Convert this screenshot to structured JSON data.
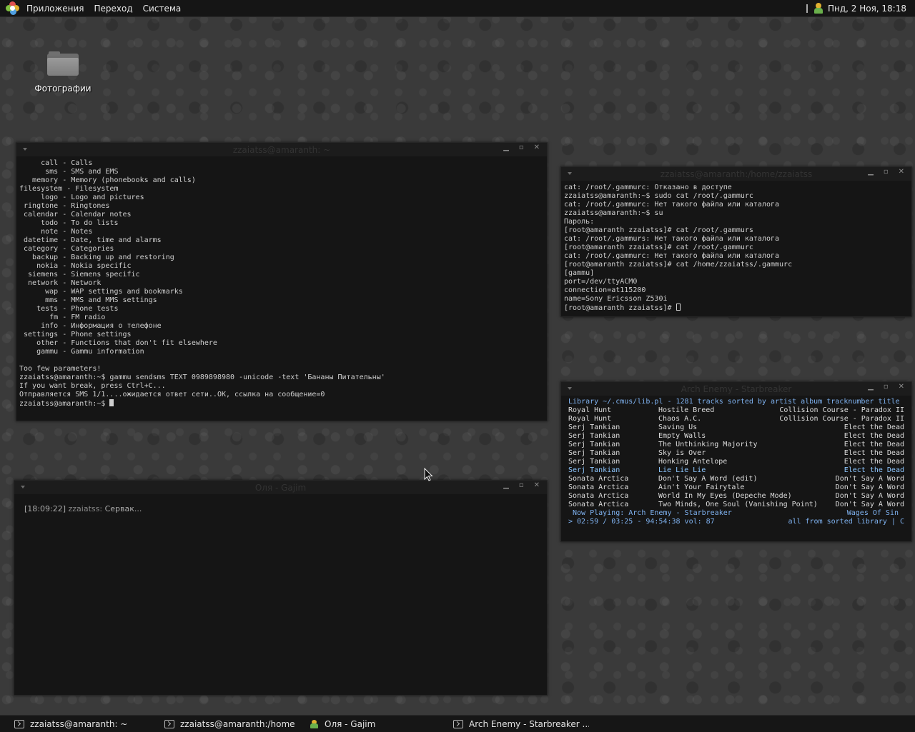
{
  "top_panel": {
    "menus": [
      "Приложения",
      "Переход",
      "Система"
    ],
    "clock": "Пнд,  2 Ноя, 18:18"
  },
  "desktop": {
    "icons": [
      {
        "label": "Фотографии",
        "icon": "folder-icon"
      }
    ]
  },
  "windows": {
    "terminal_main": {
      "title": "zzaiatss@amaranth: ~",
      "lines": [
        "     call - Calls",
        "      sms - SMS and EMS",
        "   memory - Memory (phonebooks and calls)",
        "filesystem - Filesystem",
        "     logo - Logo and pictures",
        " ringtone - Ringtones",
        " calendar - Calendar notes",
        "     todo - To do lists",
        "     note - Notes",
        " datetime - Date, time and alarms",
        " category - Categories",
        "   backup - Backing up and restoring",
        "    nokia - Nokia specific",
        "  siemens - Siemens specific",
        "  network - Network",
        "      wap - WAP settings and bookmarks",
        "      mms - MMS and MMS settings",
        "    tests - Phone tests",
        "       fm - FM radio",
        "     info - Информация о телефоне",
        " settings - Phone settings",
        "    other - Functions that don't fit elsewhere",
        "    gammu - Gammu information",
        "",
        "Too few parameters!",
        "zzaiatss@amaranth:~$ gammu sendsms TEXT 0989898980 -unicode -text 'Бананы Питательны'",
        "If you want break, press Ctrl+C...",
        "Отправляется SMS 1/1....ожидается ответ сети..OK, ссылка на сообщение=0"
      ],
      "prompt": "zzaiatss@amaranth:~$ "
    },
    "terminal_root": {
      "title": "zzaiatss@amaranth:/home/zzaiatss",
      "lines": [
        "cat: /root/.gammurc: Отказано в доступе",
        "zzaiatss@amaranth:~$ sudo cat /root/.gammurc",
        "cat: /root/.gammurc: Нет такого файла или каталога",
        "zzaiatss@amaranth:~$ su",
        "Пароль:",
        "[root@amaranth zzaiatss]# cat /root/.gammurs",
        "cat: /root/.gammurs: Нет такого файла или каталога",
        "[root@amaranth zzaiatss]# cat /root/.gammurc",
        "cat: /root/.gammurc: Нет такого файла или каталога",
        "[root@amaranth zzaiatss]# cat /home/zzaiatss/.gammurc",
        "[gammu]",
        "port=/dev/ttyACM0",
        "connection=at115200",
        "name=Sony Ericsson Z530i"
      ],
      "prompt": "[root@amaranth zzaiatss]# "
    },
    "cmus": {
      "title": "Arch Enemy - Starbreaker",
      "header": "Library ~/.cmus/lib.pl - 1281 tracks sorted by artist album tracknumber title",
      "tracks": [
        {
          "artist": "Royal Hunt",
          "title": "Hostile Breed",
          "album": "Collision Course - Paradox II"
        },
        {
          "artist": "Royal Hunt",
          "title": "Chaos A.C.",
          "album": "Collision Course - Paradox II"
        },
        {
          "artist": "Serj Tankian",
          "title": "Saving Us",
          "album": "Elect the Dead"
        },
        {
          "artist": "Serj Tankian",
          "title": "Empty Walls",
          "album": "Elect the Dead"
        },
        {
          "artist": "Serj Tankian",
          "title": "The Unthinking Majority",
          "album": "Elect the Dead"
        },
        {
          "artist": "Serj Tankian",
          "title": "Sky is Over",
          "album": "Elect the Dead"
        },
        {
          "artist": "Serj Tankian",
          "title": "Honking Antelope",
          "album": "Elect the Dead"
        },
        {
          "artist": "Serj Tankian",
          "title": "Lie Lie Lie",
          "album": "Elect the Dead",
          "selected": true
        },
        {
          "artist": "Sonata Arctica",
          "title": "Don't Say A Word (edit)",
          "album": "Don't Say A Word"
        },
        {
          "artist": "Sonata Arctica",
          "title": "Ain't Your Fairytale",
          "album": "Don't Say A Word"
        },
        {
          "artist": "Sonata Arctica",
          "title": "World In My Eyes (Depeche Mode)",
          "album": "Don't Say A Word"
        },
        {
          "artist": "Sonata Arctica",
          "title": "Two Minds, One Soul (Vanishing Point)",
          "album": "Don't Say A Word"
        }
      ],
      "now_playing": "Now Playing: Arch Enemy - Starbreaker",
      "now_playing_album": "Wages Of Sin",
      "position": "> 02:59 / 03:25 - 94:54:38 vol: 87",
      "mode": "all from sorted library | C"
    },
    "gajim_chat": {
      "title": "Оля - Gajim",
      "message_time": "[18:09:22]",
      "message_author": "zzaiatss:",
      "message_text": "Сервак..."
    }
  },
  "taskbar": {
    "tasks": [
      {
        "label": "zzaiatss@amaranth: ~",
        "icon": "terminal-icon"
      },
      {
        "label": "zzaiatss@amaranth:/home...",
        "icon": "terminal-icon"
      },
      {
        "label": "Оля - Gajim",
        "icon": "gajim-icon"
      },
      {
        "label": "Arch Enemy - Starbreaker ...",
        "icon": "terminal-icon"
      }
    ]
  },
  "colors": {
    "panel_bg": "#151515",
    "terminal_bg": "#151515",
    "cmus_blue": "#7fb2f0"
  }
}
